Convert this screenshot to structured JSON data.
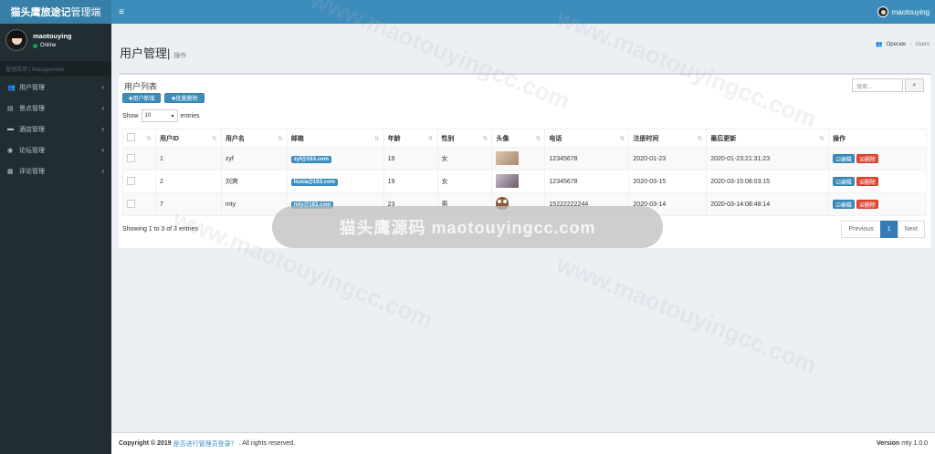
{
  "app": {
    "logo_bold": "猫头鹰旅途记",
    "logo_rest": "管理端",
    "toggle_icon": "≡"
  },
  "topbar": {
    "username": "maotouying"
  },
  "sidebar": {
    "username": "maotouying",
    "status": "Online",
    "menu_header": "管理菜单 | Management",
    "items": [
      {
        "label": "用户管理",
        "icon": "users-icon"
      },
      {
        "label": "景点管理",
        "icon": "book-icon"
      },
      {
        "label": "酒店管理",
        "icon": "bed-icon"
      },
      {
        "label": "论坛管理",
        "icon": "forum-icon"
      },
      {
        "label": "评论管理",
        "icon": "list-icon"
      }
    ]
  },
  "page": {
    "title": "用户管理|",
    "subtitle": "操作",
    "breadcrumb": [
      "Operate",
      "Users"
    ]
  },
  "box": {
    "title": "用户列表",
    "add_button": "✚用户新增",
    "batch_delete_button": "✚批量删除",
    "search_placeholder": "搜索...",
    "show_label": "Show",
    "show_value": "10",
    "entries_label": "entries"
  },
  "table": {
    "headers": [
      "",
      "用户ID",
      "用户名",
      "邮箱",
      "年龄",
      "性别",
      "头像",
      "电话",
      "注册时间",
      "最后更新",
      "操作"
    ],
    "rows": [
      {
        "id": "1",
        "name": "zyf",
        "email": "zyf@163.com",
        "age": "19",
        "gender": "女",
        "avatar": "photo-a",
        "phone": "12345678",
        "reg": "2020-01-23",
        "updated": "2020-01-23:21:31:23"
      },
      {
        "id": "2",
        "name": "刘爽",
        "email": "liuxia@163.com",
        "age": "19",
        "gender": "女",
        "avatar": "photo-b",
        "phone": "12345678",
        "reg": "2020-03-15",
        "updated": "2020-03-15:08:03:15"
      },
      {
        "id": "7",
        "name": "mty",
        "email": "mty@163.com",
        "age": "23",
        "gender": "男",
        "avatar": "owl",
        "phone": "15222222244",
        "reg": "2020-03-14",
        "updated": "2020-03-14:08:48:14"
      }
    ],
    "edit_label": "☑编辑",
    "delete_label": "☒删除"
  },
  "pagination": {
    "info": "Showing 1 to 3 of 3 entries",
    "previous": "Previous",
    "current": "1",
    "next": "Next"
  },
  "watermark": {
    "pill_text": "猫头鹰源码 maotouyingcc.com",
    "diagonal": "www.maotouyingcc.com"
  },
  "footer": {
    "copyright": "Copyright © 2019",
    "link": "是否进行管理员登录？",
    "rights": ". All rights reserved.",
    "version_label": "Version",
    "version": "mty 1.0.0"
  }
}
